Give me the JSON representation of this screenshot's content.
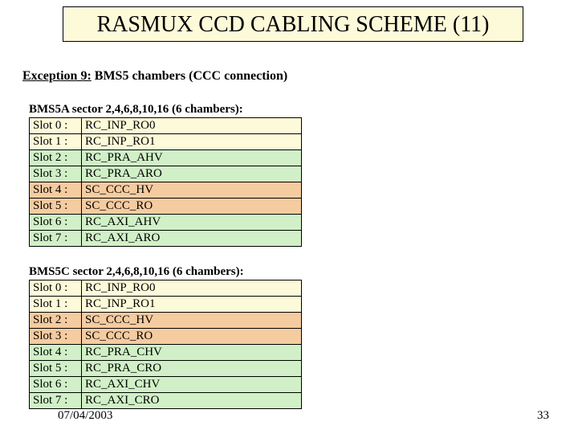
{
  "title": "RASMUX CCD CABLING SCHEME (11)",
  "exception_label": "Exception 9:",
  "exception_text": "BMS5 chambers (CCC connection)",
  "blocks": [
    {
      "title": "BMS5A sector 2,4,6,8,10,16 (6 chambers):",
      "rows": [
        {
          "slot": "Slot 0 :",
          "value": "RC_INP_RO0",
          "color": "c-yellow"
        },
        {
          "slot": "Slot 1 :",
          "value": "RC_INP_RO1",
          "color": "c-yellow"
        },
        {
          "slot": "Slot 2 :",
          "value": "RC_PRA_AHV",
          "color": "c-green"
        },
        {
          "slot": "Slot 3 :",
          "value": "RC_PRA_ARO",
          "color": "c-green"
        },
        {
          "slot": "Slot 4 :",
          "value": "SC_CCC_HV",
          "color": "c-orange"
        },
        {
          "slot": "Slot 5 :",
          "value": "SC_CCC_RO",
          "color": "c-orange"
        },
        {
          "slot": "Slot 6 :",
          "value": "RC_AXI_AHV",
          "color": "c-green"
        },
        {
          "slot": "Slot 7 :",
          "value": "RC_AXI_ARO",
          "color": "c-green"
        }
      ]
    },
    {
      "title": "BMS5C sector 2,4,6,8,10,16 (6 chambers):",
      "rows": [
        {
          "slot": "Slot 0 :",
          "value": "RC_INP_RO0",
          "color": "c-yellow"
        },
        {
          "slot": "Slot 1 :",
          "value": "RC_INP_RO1",
          "color": "c-yellow"
        },
        {
          "slot": "Slot 2 :",
          "value": "SC_CCC_HV",
          "color": "c-orange"
        },
        {
          "slot": "Slot 3 :",
          "value": "SC_CCC_RO",
          "color": "c-orange"
        },
        {
          "slot": "Slot 4 :",
          "value": "RC_PRA_CHV",
          "color": "c-green"
        },
        {
          "slot": "Slot 5 :",
          "value": "RC_PRA_CRO",
          "color": "c-green"
        },
        {
          "slot": "Slot 6 :",
          "value": "RC_AXI_CHV",
          "color": "c-green"
        },
        {
          "slot": "Slot 7 :",
          "value": "RC_AXI_CRO",
          "color": "c-green"
        }
      ]
    }
  ],
  "footer": {
    "date": "07/04/2003",
    "page": "33"
  }
}
